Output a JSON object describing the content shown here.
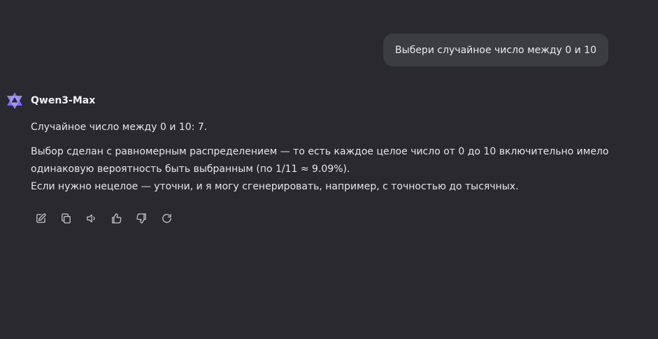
{
  "user_message": {
    "text": "Выбери случайное число между 0 и 10"
  },
  "assistant": {
    "model_name": "Qwen3-Max",
    "logo_icon": "qwen-logo-icon",
    "paragraph_1": "Случайное число между 0 и 10: 7.",
    "paragraph_2_line_1": "Выбор сделан с равномерным распределением — то есть каждое целое число от 0 до 10 включительно имело",
    "paragraph_2_line_2": "одинаковую вероятность быть выбранным (по 1/11 ≈ 9.09%).",
    "paragraph_2_line_3": "Если нужно нецелое — уточни, и я могу сгенерировать, например, с точностью до тысячных."
  },
  "actions": [
    {
      "name": "edit",
      "icon": "edit-icon"
    },
    {
      "name": "copy",
      "icon": "copy-icon"
    },
    {
      "name": "read-aloud",
      "icon": "speaker-icon"
    },
    {
      "name": "like",
      "icon": "thumbs-up-icon"
    },
    {
      "name": "dislike",
      "icon": "thumbs-down-icon"
    },
    {
      "name": "regenerate",
      "icon": "refresh-icon"
    }
  ],
  "colors": {
    "background": "#2a2930",
    "user_bubble": "#3c3c43",
    "logo_accent": "#7c6cf2"
  }
}
